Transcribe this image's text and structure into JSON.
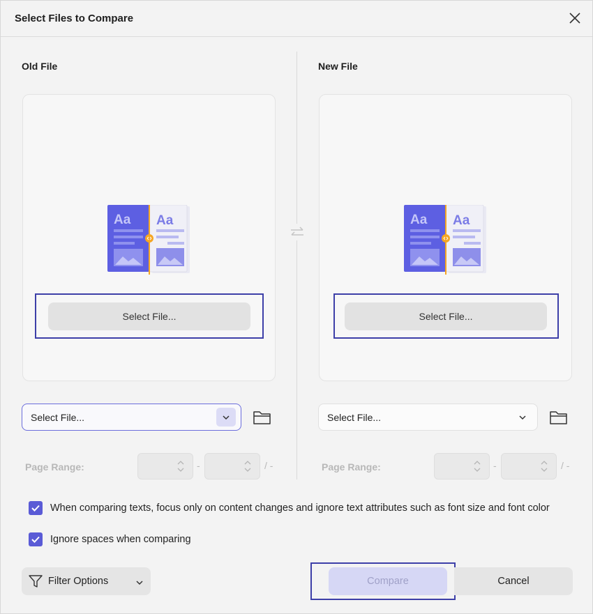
{
  "dialog": {
    "title": "Select Files to Compare"
  },
  "old_file": {
    "heading": "Old File",
    "select_button": "Select File...",
    "dropdown_value": "Select File...",
    "page_range_label": "Page Range:",
    "range_dash": "-",
    "range_slash": "/ -"
  },
  "new_file": {
    "heading": "New File",
    "select_button": "Select File...",
    "dropdown_value": "Select File...",
    "page_range_label": "Page Range:",
    "range_dash": "-",
    "range_slash": "/ -"
  },
  "options": {
    "focus_content": {
      "label": "When comparing texts, focus only on content changes and ignore text attributes such as font size and font color",
      "checked": true
    },
    "ignore_spaces": {
      "label": "Ignore spaces when comparing",
      "checked": true
    }
  },
  "footer": {
    "filter_label": "Filter Options",
    "compare_label": "Compare",
    "cancel_label": "Cancel"
  },
  "illustration": {
    "glyph_text": "Aa"
  },
  "colors": {
    "accent": "#5a5bd6",
    "highlight_border": "#3d3fa8",
    "disabled_compare_bg": "#d6d7f5",
    "illustration_blue": "#5d5fe2",
    "illustration_orange": "#f5a623"
  }
}
